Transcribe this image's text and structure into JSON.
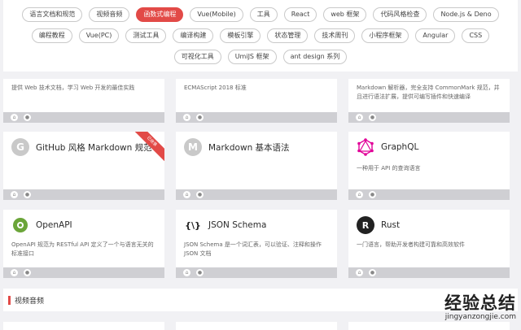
{
  "tags": {
    "row1": [
      {
        "label": "语言文档和规范",
        "active": false
      },
      {
        "label": "视频音频",
        "active": false
      },
      {
        "label": "函数式编程",
        "active": true
      },
      {
        "label": "Vue(Mobile)",
        "active": false
      },
      {
        "label": "工具",
        "active": false
      },
      {
        "label": "React",
        "active": false
      },
      {
        "label": "web 框架",
        "active": false
      },
      {
        "label": "代码风格检查",
        "active": false
      },
      {
        "label": "Node.js & Deno",
        "active": false
      }
    ],
    "row2": [
      {
        "label": "编程教程",
        "active": false
      },
      {
        "label": "Vue(PC)",
        "active": false
      },
      {
        "label": "测试工具",
        "active": false
      },
      {
        "label": "编译构建",
        "active": false
      },
      {
        "label": "模板引擎",
        "active": false
      },
      {
        "label": "状态管理",
        "active": false
      },
      {
        "label": "技术周刊",
        "active": false
      },
      {
        "label": "小程序框架",
        "active": false
      },
      {
        "label": "Angular",
        "active": false
      },
      {
        "label": "CSS",
        "active": false
      }
    ],
    "row3": [
      {
        "label": "可视化工具",
        "active": false
      },
      {
        "label": "UmiJS 框架",
        "active": false
      },
      {
        "label": "ant design 系列",
        "active": false
      }
    ]
  },
  "cards_top": [
    {
      "desc": "提供 Web 技术文档，学习 Web 开发的最佳实践"
    },
    {
      "desc": "ECMAScript 2018 标准"
    },
    {
      "desc": "Markdown 解析器，完全支持 CommonMark 规范，并且进行语法扩展，提供可编写插件和快速编译"
    }
  ],
  "cards_mid": [
    {
      "logo": "G",
      "title": "GitHub 风格 Markdown 规范",
      "desc": "",
      "ribbon": "已收录"
    },
    {
      "logo": "M",
      "title": "Markdown 基本语法",
      "desc": ""
    },
    {
      "logo": "graphql-logo",
      "title": "GraphQL",
      "desc": "一种用于 API 的查询语言"
    }
  ],
  "cards_bottom": [
    {
      "logo": "openapi-logo",
      "title": "OpenAPI",
      "desc": "OpenAPI 规范为 RESTful API 定义了一个与语言无关的标准接口"
    },
    {
      "logo": "{\\}",
      "title": "JSON Schema",
      "desc": "JSON Schema 是一个词汇表，可以验证、注释和操作 JSON 文档"
    },
    {
      "logo": "R",
      "title": "Rust",
      "desc": "一门语言，帮助开发者构建可靠和高效软件"
    }
  ],
  "section": {
    "title": "视频音频"
  },
  "watermark": {
    "zh": "经验总结",
    "en": "jingyanzongjie.com"
  },
  "colors": {
    "accent": "#e24a47",
    "openapi": "#6ba539",
    "graphql": "#e10098"
  }
}
